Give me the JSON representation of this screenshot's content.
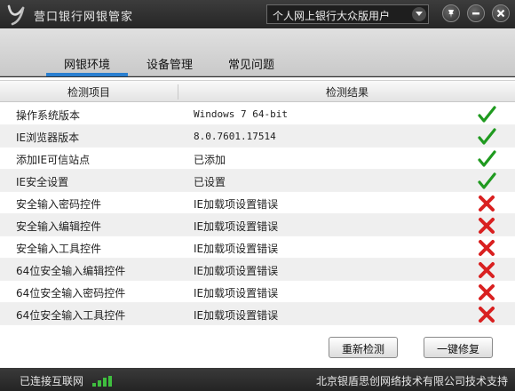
{
  "app": {
    "title": "营口银行网银管家",
    "user_mode": "个人网上银行大众版用户"
  },
  "tabs": [
    {
      "label": "网银环境",
      "active": true
    },
    {
      "label": "设备管理",
      "active": false
    },
    {
      "label": "常见问题",
      "active": false
    }
  ],
  "table": {
    "headers": {
      "item": "检测项目",
      "result": "检测结果"
    },
    "rows": [
      {
        "item": "操作系统版本",
        "result": "Windows 7 64-bit",
        "status": "ok"
      },
      {
        "item": "IE浏览器版本",
        "result": "8.0.7601.17514",
        "status": "ok"
      },
      {
        "item": "添加IE可信站点",
        "result": "已添加",
        "status": "ok"
      },
      {
        "item": "IE安全设置",
        "result": "已设置",
        "status": "ok"
      },
      {
        "item": "安全输入密码控件",
        "result": "IE加载项设置错误",
        "status": "error"
      },
      {
        "item": "安全输入编辑控件",
        "result": "IE加载项设置错误",
        "status": "error"
      },
      {
        "item": "安全输入工具控件",
        "result": "IE加载项设置错误",
        "status": "error"
      },
      {
        "item": "64位安全输入编辑控件",
        "result": "IE加载项设置错误",
        "status": "error"
      },
      {
        "item": "64位安全输入密码控件",
        "result": "IE加载项设置错误",
        "status": "error"
      },
      {
        "item": "64位安全输入工具控件",
        "result": "IE加载项设置错误",
        "status": "error"
      }
    ]
  },
  "actions": {
    "recheck": "重新检测",
    "repair": "一键修复"
  },
  "statusbar": {
    "network": "已连接互联网",
    "support": "北京银盾思创网络技术有限公司技术支持"
  },
  "colors": {
    "ok": "#1f9a1f",
    "error": "#d92020",
    "tab_active": "#2a7fd0"
  },
  "icons": {
    "logo": "bank-logo-icon",
    "dropdown": "chevron-down-icon",
    "pin": "pin-icon",
    "minimize": "minimize-icon",
    "close": "close-icon",
    "ok": "check-icon",
    "error": "cross-icon",
    "network": "signal-bars-icon"
  }
}
